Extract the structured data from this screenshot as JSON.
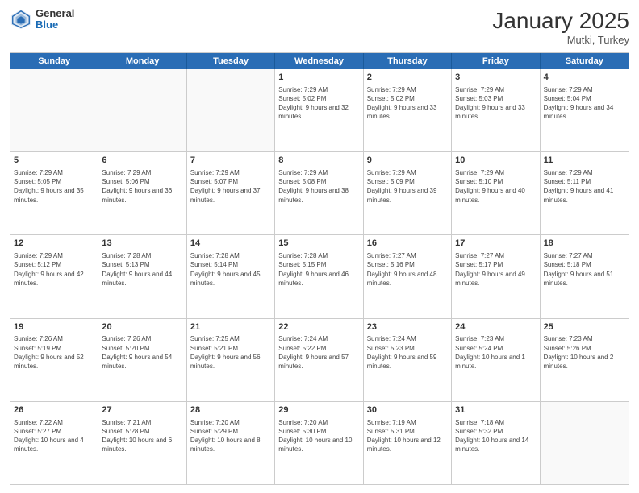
{
  "logo": {
    "general": "General",
    "blue": "Blue"
  },
  "title": "January 2025",
  "location": "Mutki, Turkey",
  "days_of_week": [
    "Sunday",
    "Monday",
    "Tuesday",
    "Wednesday",
    "Thursday",
    "Friday",
    "Saturday"
  ],
  "weeks": [
    [
      {
        "day": "",
        "info": ""
      },
      {
        "day": "",
        "info": ""
      },
      {
        "day": "",
        "info": ""
      },
      {
        "day": "1",
        "sunrise": "7:29 AM",
        "sunset": "5:02 PM",
        "daylight": "9 hours and 32 minutes."
      },
      {
        "day": "2",
        "sunrise": "7:29 AM",
        "sunset": "5:02 PM",
        "daylight": "9 hours and 33 minutes."
      },
      {
        "day": "3",
        "sunrise": "7:29 AM",
        "sunset": "5:03 PM",
        "daylight": "9 hours and 33 minutes."
      },
      {
        "day": "4",
        "sunrise": "7:29 AM",
        "sunset": "5:04 PM",
        "daylight": "9 hours and 34 minutes."
      }
    ],
    [
      {
        "day": "5",
        "sunrise": "7:29 AM",
        "sunset": "5:05 PM",
        "daylight": "9 hours and 35 minutes."
      },
      {
        "day": "6",
        "sunrise": "7:29 AM",
        "sunset": "5:06 PM",
        "daylight": "9 hours and 36 minutes."
      },
      {
        "day": "7",
        "sunrise": "7:29 AM",
        "sunset": "5:07 PM",
        "daylight": "9 hours and 37 minutes."
      },
      {
        "day": "8",
        "sunrise": "7:29 AM",
        "sunset": "5:08 PM",
        "daylight": "9 hours and 38 minutes."
      },
      {
        "day": "9",
        "sunrise": "7:29 AM",
        "sunset": "5:09 PM",
        "daylight": "9 hours and 39 minutes."
      },
      {
        "day": "10",
        "sunrise": "7:29 AM",
        "sunset": "5:10 PM",
        "daylight": "9 hours and 40 minutes."
      },
      {
        "day": "11",
        "sunrise": "7:29 AM",
        "sunset": "5:11 PM",
        "daylight": "9 hours and 41 minutes."
      }
    ],
    [
      {
        "day": "12",
        "sunrise": "7:29 AM",
        "sunset": "5:12 PM",
        "daylight": "9 hours and 42 minutes."
      },
      {
        "day": "13",
        "sunrise": "7:28 AM",
        "sunset": "5:13 PM",
        "daylight": "9 hours and 44 minutes."
      },
      {
        "day": "14",
        "sunrise": "7:28 AM",
        "sunset": "5:14 PM",
        "daylight": "9 hours and 45 minutes."
      },
      {
        "day": "15",
        "sunrise": "7:28 AM",
        "sunset": "5:15 PM",
        "daylight": "9 hours and 46 minutes."
      },
      {
        "day": "16",
        "sunrise": "7:27 AM",
        "sunset": "5:16 PM",
        "daylight": "9 hours and 48 minutes."
      },
      {
        "day": "17",
        "sunrise": "7:27 AM",
        "sunset": "5:17 PM",
        "daylight": "9 hours and 49 minutes."
      },
      {
        "day": "18",
        "sunrise": "7:27 AM",
        "sunset": "5:18 PM",
        "daylight": "9 hours and 51 minutes."
      }
    ],
    [
      {
        "day": "19",
        "sunrise": "7:26 AM",
        "sunset": "5:19 PM",
        "daylight": "9 hours and 52 minutes."
      },
      {
        "day": "20",
        "sunrise": "7:26 AM",
        "sunset": "5:20 PM",
        "daylight": "9 hours and 54 minutes."
      },
      {
        "day": "21",
        "sunrise": "7:25 AM",
        "sunset": "5:21 PM",
        "daylight": "9 hours and 56 minutes."
      },
      {
        "day": "22",
        "sunrise": "7:24 AM",
        "sunset": "5:22 PM",
        "daylight": "9 hours and 57 minutes."
      },
      {
        "day": "23",
        "sunrise": "7:24 AM",
        "sunset": "5:23 PM",
        "daylight": "9 hours and 59 minutes."
      },
      {
        "day": "24",
        "sunrise": "7:23 AM",
        "sunset": "5:24 PM",
        "daylight": "10 hours and 1 minute."
      },
      {
        "day": "25",
        "sunrise": "7:23 AM",
        "sunset": "5:26 PM",
        "daylight": "10 hours and 2 minutes."
      }
    ],
    [
      {
        "day": "26",
        "sunrise": "7:22 AM",
        "sunset": "5:27 PM",
        "daylight": "10 hours and 4 minutes."
      },
      {
        "day": "27",
        "sunrise": "7:21 AM",
        "sunset": "5:28 PM",
        "daylight": "10 hours and 6 minutes."
      },
      {
        "day": "28",
        "sunrise": "7:20 AM",
        "sunset": "5:29 PM",
        "daylight": "10 hours and 8 minutes."
      },
      {
        "day": "29",
        "sunrise": "7:20 AM",
        "sunset": "5:30 PM",
        "daylight": "10 hours and 10 minutes."
      },
      {
        "day": "30",
        "sunrise": "7:19 AM",
        "sunset": "5:31 PM",
        "daylight": "10 hours and 12 minutes."
      },
      {
        "day": "31",
        "sunrise": "7:18 AM",
        "sunset": "5:32 PM",
        "daylight": "10 hours and 14 minutes."
      },
      {
        "day": "",
        "info": ""
      }
    ]
  ]
}
